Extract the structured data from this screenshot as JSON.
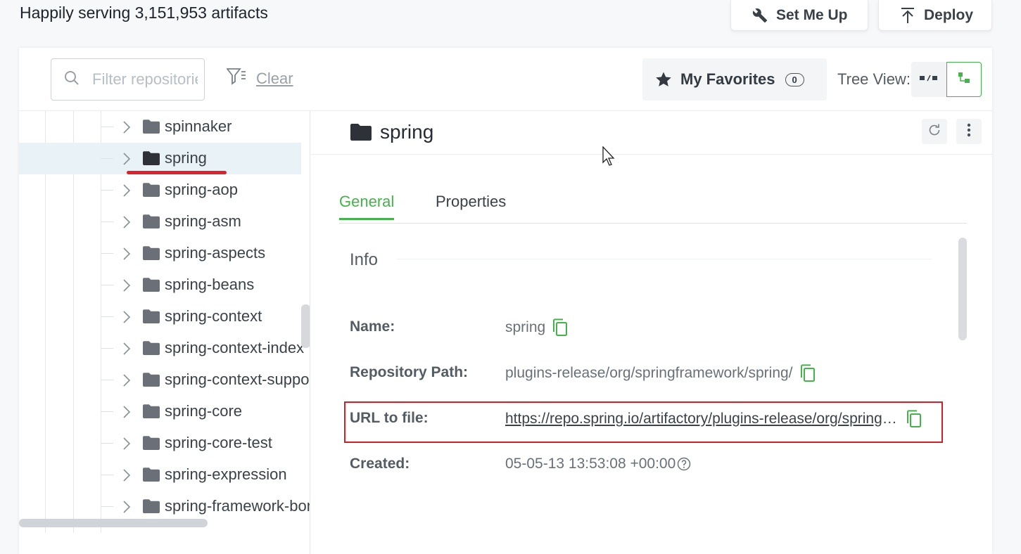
{
  "header": {
    "serving_text": "Happily serving 3,151,953 artifacts",
    "setup_label": "Set Me Up",
    "deploy_label": "Deploy"
  },
  "toolbar": {
    "filter_placeholder": "Filter repositories",
    "clear_label": "Clear",
    "favorites_label": "My Favorites",
    "favorites_count": "0",
    "tree_view_label": "Tree View:"
  },
  "tree": {
    "items": [
      {
        "label": "spinnaker"
      },
      {
        "label": "spring",
        "selected": true
      },
      {
        "label": "spring-aop"
      },
      {
        "label": "spring-asm"
      },
      {
        "label": "spring-aspects"
      },
      {
        "label": "spring-beans"
      },
      {
        "label": "spring-context"
      },
      {
        "label": "spring-context-index"
      },
      {
        "label": "spring-context-support"
      },
      {
        "label": "spring-core"
      },
      {
        "label": "spring-core-test"
      },
      {
        "label": "spring-expression"
      },
      {
        "label": "spring-framework-bom"
      }
    ]
  },
  "detail": {
    "title": "spring",
    "tabs": [
      {
        "label": "General",
        "active": true
      },
      {
        "label": "Properties"
      }
    ],
    "info_title": "Info",
    "fields": {
      "name_label": "Name:",
      "name_value": "spring",
      "path_label": "Repository Path:",
      "path_value": "plugins-release/org/springframework/spring/",
      "url_label": "URL to file:",
      "url_value": "https://repo.spring.io/artifactory/plugins-release/org/springframework/spring/",
      "created_label": "Created:",
      "created_value": "05-05-13 13:53:08 +00:00"
    }
  },
  "colors": {
    "accent": "#43b34a",
    "highlight": "#d0202a",
    "selected_row": "#e9f2f7"
  }
}
